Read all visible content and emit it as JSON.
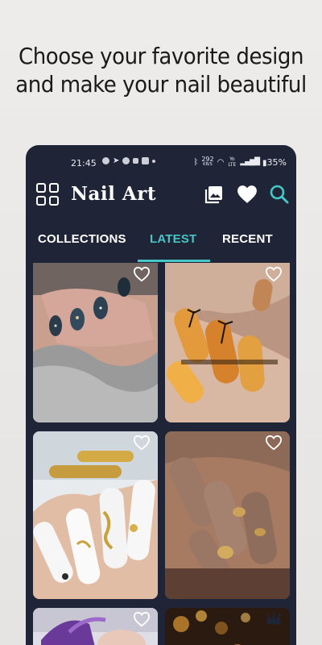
{
  "promo": {
    "line1": "Choose your favorite design",
    "line2": "and make your nail beautiful"
  },
  "status_bar": {
    "time": "21:45",
    "data_speed": "292",
    "data_unit": "KB/S",
    "network": "Yo LTE",
    "battery": "35%"
  },
  "app": {
    "title": "Nail Art",
    "icons": [
      "grid-icon",
      "gallery-icon",
      "heart-icon",
      "search-icon"
    ],
    "accent": "#45c7c7",
    "background": "#1f2437"
  },
  "tabs": [
    {
      "label": "COLLECTIONS",
      "active": false
    },
    {
      "label": "LATEST",
      "active": true
    },
    {
      "label": "RECENT",
      "active": false
    }
  ],
  "cards": [
    {
      "id": 1,
      "badge": "heart-outline-icon"
    },
    {
      "id": 2,
      "badge": "heart-outline-icon"
    },
    {
      "id": 3,
      "badge": "heart-outline-icon"
    },
    {
      "id": 4,
      "badge": "heart-outline-icon"
    },
    {
      "id": 5,
      "badge": "heart-outline-icon"
    },
    {
      "id": 6,
      "badge": "crown-icon"
    }
  ]
}
